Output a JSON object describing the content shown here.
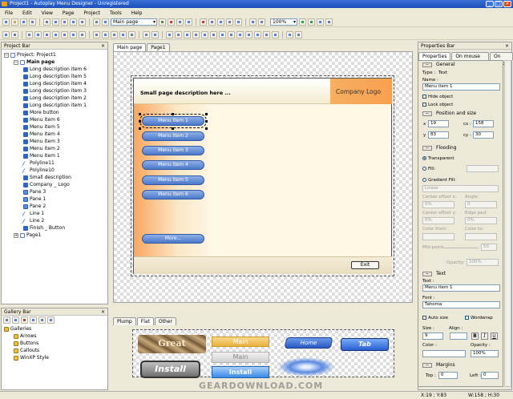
{
  "window": {
    "title": "Project1 - Autoplay Menu Designer - Unregistered"
  },
  "menu": [
    "File",
    "Edit",
    "View",
    "Page",
    "Project",
    "Tools",
    "Help"
  ],
  "toolbar": {
    "page_combo": "Main page",
    "zoom_combo": "100%"
  },
  "project_bar": {
    "title": "Project Bar",
    "items": [
      {
        "label": "Project: Project1",
        "level": 0,
        "icon": "pg"
      },
      {
        "label": "Main page",
        "level": 1,
        "icon": "pg",
        "bold": true
      },
      {
        "label": "Long description item 6",
        "level": 2,
        "icon": "a"
      },
      {
        "label": "Long description item 5",
        "level": 2,
        "icon": "a"
      },
      {
        "label": "Long description item 4",
        "level": 2,
        "icon": "a"
      },
      {
        "label": "Long description item 3",
        "level": 2,
        "icon": "a"
      },
      {
        "label": "Long description item 2",
        "level": 2,
        "icon": "a"
      },
      {
        "label": "Long description item 1",
        "level": 2,
        "icon": "a"
      },
      {
        "label": "More button",
        "level": 2,
        "icon": "a"
      },
      {
        "label": "Menu item 6",
        "level": 2,
        "icon": "a"
      },
      {
        "label": "Menu item 5",
        "level": 2,
        "icon": "a"
      },
      {
        "label": "Menu item 4",
        "level": 2,
        "icon": "a"
      },
      {
        "label": "Menu item 3",
        "level": 2,
        "icon": "a"
      },
      {
        "label": "Menu item 2",
        "level": 2,
        "icon": "a"
      },
      {
        "label": "Menu item 1",
        "level": 2,
        "icon": "a"
      },
      {
        "label": "Polyline11",
        "level": 2,
        "icon": "ln"
      },
      {
        "label": "Polyline10",
        "level": 2,
        "icon": "ln"
      },
      {
        "label": "Small description",
        "level": 2,
        "icon": "a"
      },
      {
        "label": "Company _ Logo",
        "level": 2,
        "icon": "a"
      },
      {
        "label": "Pane 3",
        "level": 2,
        "icon": "pn"
      },
      {
        "label": "Pane 1",
        "level": 2,
        "icon": "pn"
      },
      {
        "label": "Pane 2",
        "level": 2,
        "icon": "pn"
      },
      {
        "label": "Line 1",
        "level": 2,
        "icon": "ln"
      },
      {
        "label": "Line 2",
        "level": 2,
        "icon": "ln"
      },
      {
        "label": "Finish _ Button",
        "level": 2,
        "icon": "a"
      },
      {
        "label": "Page1",
        "level": 1,
        "icon": "pg"
      }
    ]
  },
  "editor": {
    "tabs": [
      "Main page",
      "Page1"
    ],
    "small_description": "Small page description here ...",
    "company_logo": "Company Logo",
    "menu_items": [
      "Menu item 1",
      "Menu item 2",
      "Menu item 3",
      "Menu item 4",
      "Menu item 5",
      "Menu item 6"
    ],
    "more_button": "More...",
    "exit_button": "Exit"
  },
  "gallery_bar": {
    "title": "Gallery Bar",
    "tree": [
      {
        "label": "Galleries",
        "level": 0
      },
      {
        "label": "Arrows",
        "level": 1
      },
      {
        "label": "Buttons",
        "level": 1
      },
      {
        "label": "Callouts",
        "level": 1
      },
      {
        "label": "WinXP Style",
        "level": 1
      }
    ],
    "tabs": [
      "Plump",
      "Flat",
      "Other"
    ],
    "samples": {
      "stone": "Great",
      "main_orange": "Main",
      "main_gray": "Main",
      "home": "Home",
      "tab": "Tab",
      "install_dark": "Install",
      "install_blue": "Install"
    }
  },
  "properties_bar": {
    "title": "Properties Bar",
    "tabs": [
      "Properties",
      "On mouse over",
      "On click"
    ],
    "general_head": "General",
    "type_label": "Type :",
    "type_value": "Text",
    "name_label": "Name :",
    "name_value": "Menu item 1",
    "hide_object": "Hide object",
    "lock_object": "Lock object",
    "pos_head": "Position and size",
    "x_label": "x",
    "x_value": "19",
    "y_label": "y",
    "y_value": "83",
    "cx_label": "cx :",
    "cx_value": "158",
    "cy_label": "cy :",
    "cy_value": "30",
    "flooding_head": "Flooding",
    "transparent": "Transparent",
    "fill": "Fill:",
    "gradient_fill": "Gradient Fill:",
    "gradient_type": "Linear",
    "center_offset_x": "Center offset x:",
    "center_offset_x_val": "0%",
    "angle": "Angle:",
    "angle_val": "0",
    "center_offset_y": "Center offset y:",
    "center_offset_y_val": "0%",
    "edge_pad": "Edge pad:",
    "edge_pad_val": "0%",
    "color_from": "Color from:",
    "color_to": "Color to:",
    "mid_point": "Mid-point:",
    "mid_point_val": "50",
    "opacity_label": "Opacity:",
    "opacity_val": "100%",
    "text_head": "Text",
    "text_label": "Text :",
    "text_value": "Menu item 1",
    "font_label": "Font :",
    "font_value": "Tahoma",
    "auto_size": "Auto size",
    "wordwrap": "Wordwrap",
    "size_label": "Size :",
    "size_value": "9",
    "align_label": "Align :",
    "color_label": "Color :",
    "opacity2_label": "Opacity :",
    "opacity2_val": "100%",
    "margins_head": "Margins",
    "top_label": "Top :",
    "top_val": "0",
    "left_label": "Left :",
    "left_val": "0"
  },
  "status": {
    "coords": "X:19 ; Y:83",
    "size": "W:158 ; H:30"
  },
  "watermark": "GEARDOWNLOAD.COM"
}
